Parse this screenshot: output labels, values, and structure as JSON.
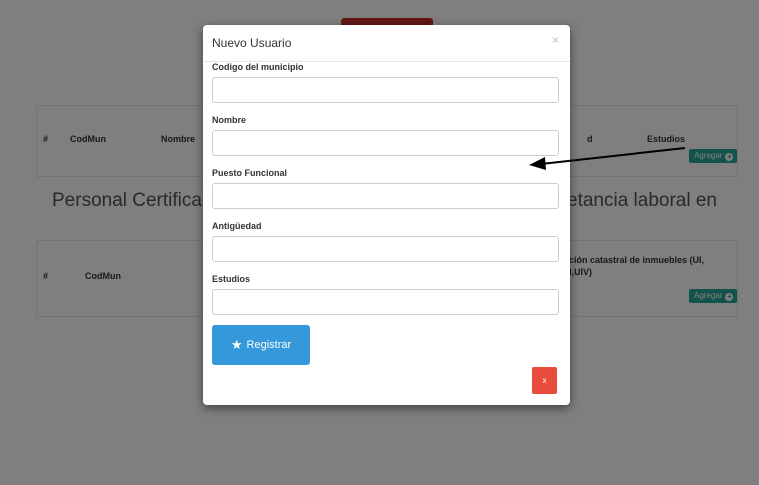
{
  "background": {
    "table1_headers": [
      "#",
      "CodMun",
      "Nombre",
      "d",
      "Estudios"
    ],
    "table1_agregar": "Agregar",
    "section_title_left": "Personal Certifica",
    "section_title_right": "etancia laboral en",
    "table2_headers": [
      "#",
      "CodMun"
    ],
    "table2_right_line1": "ción catastral de inmuebles (UI,",
    "table2_right_line2": "I,UIV)",
    "table2_agregar": "Agregar"
  },
  "modal": {
    "title": "Nuevo Usuario",
    "close_icon": "×",
    "fields": [
      {
        "label": "Codigo del municipio",
        "value": ""
      },
      {
        "label": "Nombre",
        "value": ""
      },
      {
        "label": "Puesto Funcional",
        "value": ""
      },
      {
        "label": "Antigüedad",
        "value": ""
      },
      {
        "label": "Estudios",
        "value": ""
      }
    ],
    "register_label": "Registrar",
    "register_icon": "star-icon",
    "close_button_label": "x"
  },
  "colors": {
    "overlay": "rgba(0,0,0,0.5)",
    "teal_button": "#26a69a",
    "register_button": "#3498db",
    "close_button": "#e74c3c",
    "top_red_button": "#c9302c"
  }
}
